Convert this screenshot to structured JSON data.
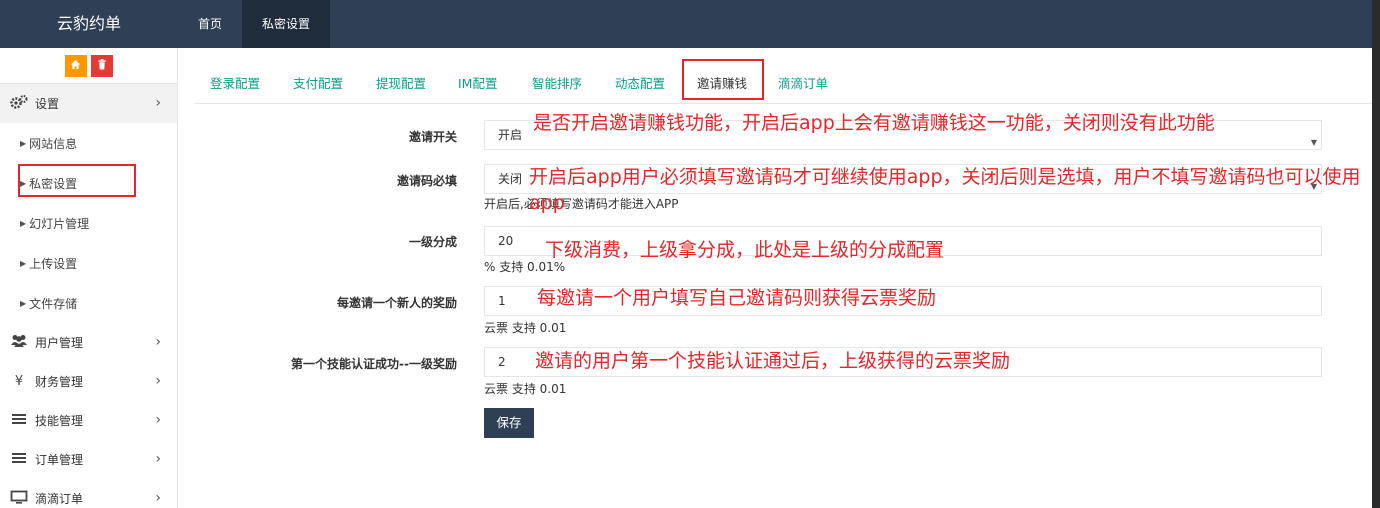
{
  "app": {
    "title": "云豹约单"
  },
  "top_nav": [
    {
      "label": "首页"
    },
    {
      "label": "私密设置"
    }
  ],
  "sidebar": {
    "tools": {
      "home_icon": "home-icon",
      "delete_icon": "trash-icon"
    },
    "settings_label": "设置",
    "sub_items": [
      {
        "label": "网站信息"
      },
      {
        "label": "私密设置"
      },
      {
        "label": "幻灯片管理"
      },
      {
        "label": "上传设置"
      },
      {
        "label": "文件存储"
      }
    ],
    "menus": [
      {
        "label": "用户管理",
        "icon": "users-icon"
      },
      {
        "label": "财务管理",
        "icon": "yen-icon"
      },
      {
        "label": "技能管理",
        "icon": "list-icon"
      },
      {
        "label": "订单管理",
        "icon": "list-icon"
      },
      {
        "label": "滴滴订单",
        "icon": "monitor-icon"
      }
    ]
  },
  "tabs": [
    {
      "label": "登录配置"
    },
    {
      "label": "支付配置"
    },
    {
      "label": "提现配置"
    },
    {
      "label": "IM配置"
    },
    {
      "label": "智能排序"
    },
    {
      "label": "动态配置"
    },
    {
      "label": "邀请赚钱"
    },
    {
      "label": "滴滴订单"
    }
  ],
  "form": {
    "invite_switch": {
      "label": "邀请开关",
      "value": "开启"
    },
    "invite_code_required": {
      "label": "邀请码必填",
      "value": "关闭",
      "hint": "开启后,必须填写邀请码才能进入APP"
    },
    "level1_share": {
      "label": "一级分成",
      "value": "20",
      "hint": "% 支持 0.01%"
    },
    "new_user_reward": {
      "label": "每邀请一个新人的奖励",
      "value": "1",
      "hint": "云票 支持 0.01"
    },
    "skill_cert_reward": {
      "label": "第一个技能认证成功--一级奖励",
      "value": "2",
      "hint": "云票 支持 0.01"
    },
    "save_label": "保存"
  },
  "annotations": {
    "a1": "是否开启邀请赚钱功能，开启后app上会有邀请赚钱这一功能，关闭则没有此功能",
    "a2": "开启后app用户必须填写邀请码才可继续使用app，关闭后则是选填，用户不填写邀请码也可以使用app",
    "a3": "下级消费，上级拿分成，此处是上级的分成配置",
    "a4": "每邀请一个用户填写自己邀请码则获得云票奖励",
    "a5": "邀请的用户第一个技能认证通过后，上级获得的云票奖励"
  },
  "colors": {
    "topbar": "#2f4056",
    "tab_text": "#0a9e8a",
    "annotation": "#e8262a",
    "home_btn": "#ff9800",
    "delete_btn": "#e53935"
  }
}
